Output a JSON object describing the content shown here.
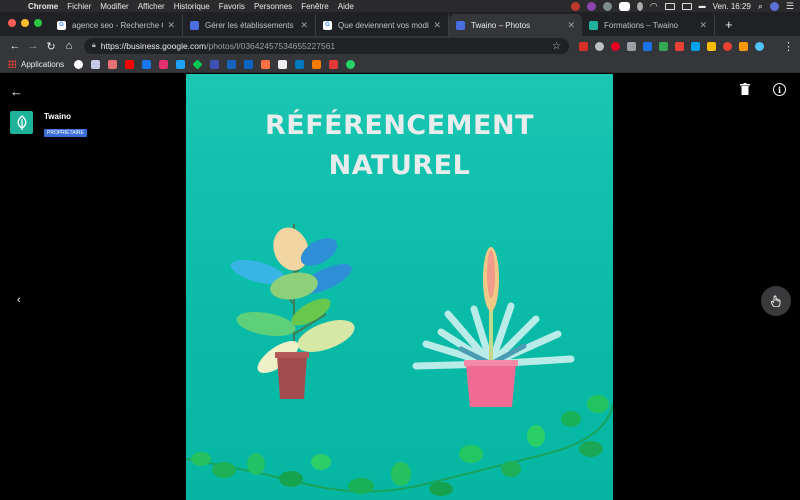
{
  "menubar": {
    "app": "Chrome",
    "items": [
      "Fichier",
      "Modifier",
      "Afficher",
      "Historique",
      "Favoris",
      "Personnes",
      "Fenêtre",
      "Aide"
    ],
    "clock": "Ven. 16:29"
  },
  "tabs": [
    {
      "title": "agence seo - Recherche Googl",
      "favicon_color": "#ffffff",
      "active": false
    },
    {
      "title": "Gérer les établissements",
      "favicon_color": "#4a6ee0",
      "active": false
    },
    {
      "title": "Que deviennent vos modificati",
      "favicon_color": "#ffffff",
      "active": false
    },
    {
      "title": "Twaino – Photos",
      "favicon_color": "#4a6ee0",
      "active": true
    },
    {
      "title": "Formations – Twaino",
      "favicon_color": "#1fb39c",
      "active": false
    }
  ],
  "omnibox": {
    "url_host": "https://business.google.com",
    "url_path": "/photos/l/03642457534655227561"
  },
  "bookmarks": {
    "apps_label": "Applications"
  },
  "viewer": {
    "business_name": "Twaino",
    "role_badge": "PROPRIÉTAIRE",
    "photo_title_line1": "RÉFÉRENCEMENT",
    "photo_title_line2": "NATUREL"
  },
  "colors": {
    "photo_bg": "#09bba7",
    "brand_teal": "#1fb39c",
    "badge_blue": "#3b6fd8"
  }
}
